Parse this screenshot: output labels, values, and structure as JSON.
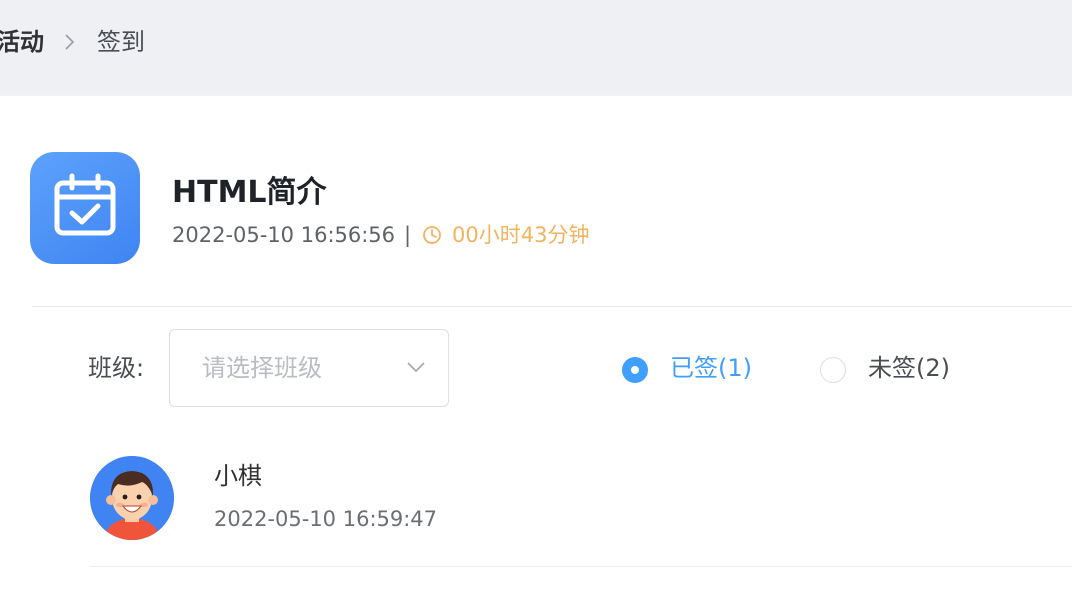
{
  "breadcrumb": {
    "parent": "活动",
    "current": "签到"
  },
  "event": {
    "title": "HTML简介",
    "date": "2022-05-10 16:56:56",
    "separator": "|",
    "duration": "00小时43分钟",
    "icon": "calendar-check-icon"
  },
  "filter": {
    "class_label": "班级:",
    "class_placeholder": "请选择班级",
    "signed_label": "已签(1)",
    "unsigned_label": "未签(2)",
    "selected": "signed"
  },
  "students": [
    {
      "name": "小棋",
      "time": "2022-05-10 16:59:47",
      "avatar": "boy-avatar"
    }
  ],
  "colors": {
    "accent": "#409eff",
    "duration": "#f3b35f",
    "icon_bg": "#4a8ff6"
  }
}
